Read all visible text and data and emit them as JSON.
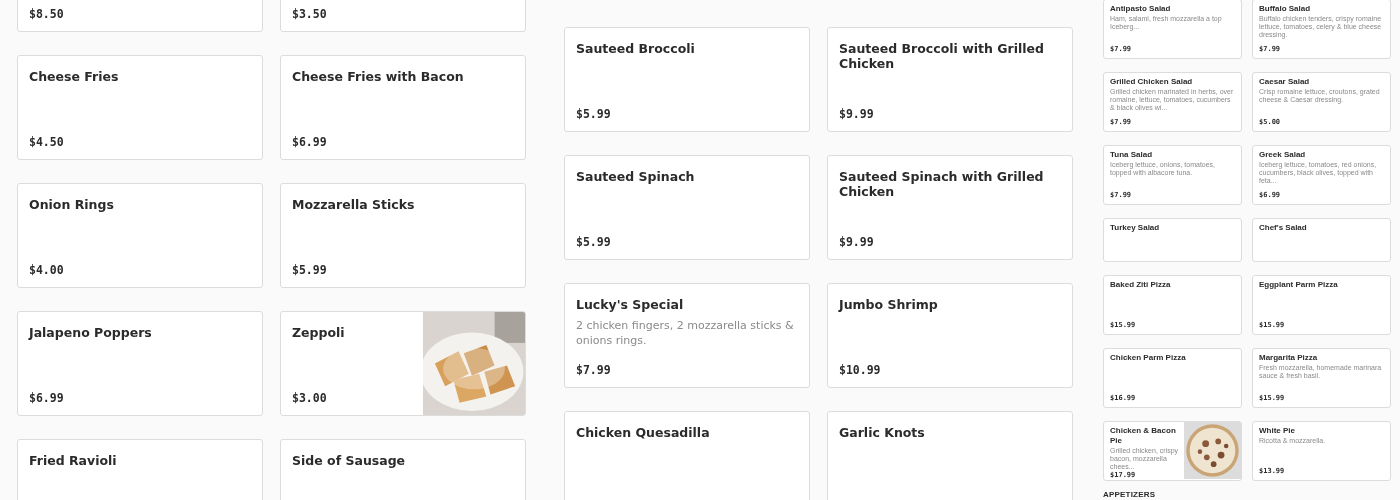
{
  "panels": [
    {
      "compact": false,
      "sections": [
        {
          "items": [
            {
              "price": "$8.50"
            },
            {
              "price": "$3.50"
            },
            {
              "name": "Cheese Fries",
              "price": "$4.50"
            },
            {
              "name": "Cheese Fries with Bacon",
              "price": "$6.99"
            },
            {
              "name": "Onion Rings",
              "price": "$4.00"
            },
            {
              "name": "Mozzarella Sticks",
              "price": "$5.99"
            },
            {
              "name": "Jalapeno Poppers",
              "price": "$6.99"
            },
            {
              "name": "Zeppoli",
              "price": "$3.00"
            },
            {
              "name": "Fried Ravioli"
            },
            {
              "name": "Side of Sausage"
            }
          ]
        }
      ]
    },
    {
      "compact": false,
      "sections": [
        {
          "items": [
            {
              "name": "Sauteed Broccoli",
              "price": "$5.99"
            },
            {
              "name": "Sauteed Broccoli with Grilled Chicken",
              "price": "$9.99"
            },
            {
              "name": "Sauteed Spinach",
              "price": "$5.99"
            },
            {
              "name": "Sauteed Spinach with Grilled Chicken",
              "price": "$9.99"
            },
            {
              "name": "Lucky's Special",
              "description": "2 chicken fingers, 2 mozzarella sticks & onions rings.",
              "price": "$7.99"
            },
            {
              "name": "Jumbo Shrimp",
              "price": "$10.99"
            },
            {
              "name": "Chicken Quesadilla"
            },
            {
              "name": "Garlic Knots"
            }
          ]
        }
      ]
    },
    {
      "compact": true,
      "sections": [
        {
          "items": [
            {
              "name": "Antipasto Salad",
              "description": "Ham, salami, fresh mozzarella a top Iceberg...",
              "price": "$7.99"
            },
            {
              "name": "Buffalo Salad",
              "description": "Buffalo chicken tenders, crispy romaine lettuce, tomatoes, celery & blue cheese dressing.",
              "price": "$7.99"
            },
            {
              "name": "Grilled Chicken Salad",
              "description": "Grilled chicken marinated in herbs, over romaine, lettuce, tomatoes, cucumbers & black olives wi...",
              "price": "$7.99"
            },
            {
              "name": "Caesar Salad",
              "description": "Crisp romaine lettuce, croutons, grated cheese & Caesar dressing.",
              "price": "$5.00"
            },
            {
              "name": "Tuna Salad",
              "description": "Iceberg lettuce, onions, tomatoes, topped with albacore tuna.",
              "price": "$7.99"
            },
            {
              "name": "Greek Salad",
              "description": "Iceberg lettuce, tomatoes, red onions, cucumbers, black olives, topped with feta...",
              "price": "$6.99"
            },
            {
              "name": "Turkey Salad"
            },
            {
              "name": "Chef's Salad"
            },
            {
              "name": "Baked Ziti Pizza",
              "price": "$15.99"
            },
            {
              "name": "Eggplant Parm Pizza",
              "price": "$15.99"
            },
            {
              "name": "Chicken Parm Pizza",
              "price": "$16.99"
            },
            {
              "name": "Margarita Pizza",
              "description": "Fresh mozzarella, homemade marinara sauce & fresh basil.",
              "price": "$15.99"
            },
            {
              "name": "Chicken & Bacon Pie",
              "description": "Grilled chicken, crispy bacon, mozzarella chees...",
              "price": "$17.99"
            },
            {
              "name": "White Pie",
              "description": "Ricotta & mozzarella.",
              "price": "$13.99"
            }
          ]
        },
        {
          "heading": "APPETIZERS"
        }
      ]
    }
  ]
}
